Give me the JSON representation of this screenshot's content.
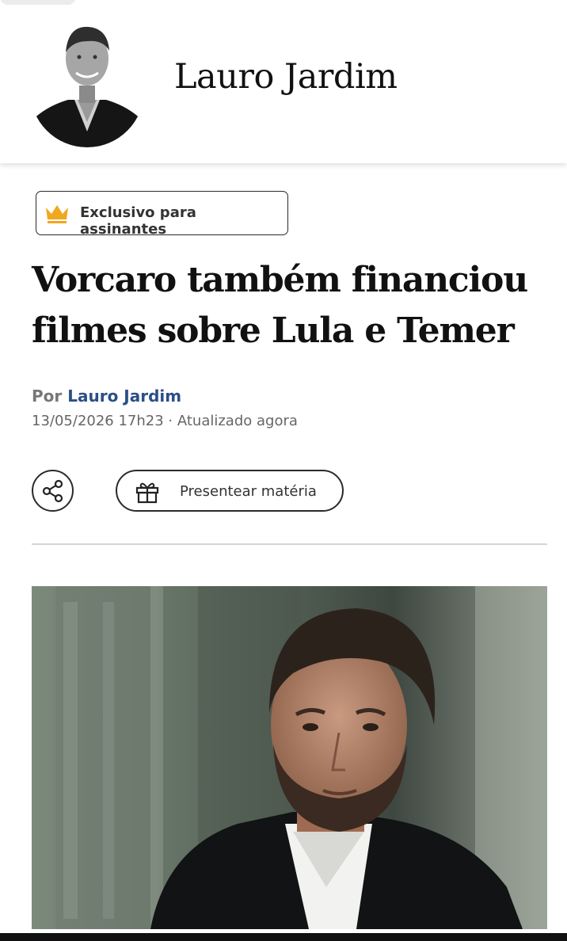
{
  "header": {
    "columnist_name": "Lauro Jardim",
    "avatar_icon": "columnist-portrait"
  },
  "article": {
    "badge": {
      "icon": "crown-icon",
      "label": "Exclusivo para assinantes",
      "accent_color": "#f0a81e"
    },
    "headline_line1": "Vorcaro também financiou",
    "headline_line2": "filmes sobre Lula e Temer",
    "byline_prefix": "Por",
    "author": "Lauro Jardim",
    "author_color": "#2b4f86",
    "dateline": "13/05/2026 17h23 · Atualizado agora",
    "actions": {
      "share_icon": "share-icon",
      "gift_icon": "gift-icon",
      "gift_label": "Presentear matéria"
    },
    "photo_subject": "article-photo"
  }
}
